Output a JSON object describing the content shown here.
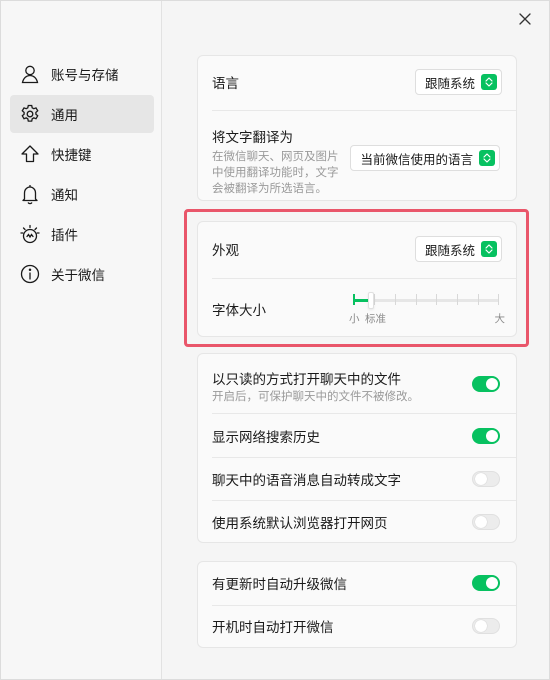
{
  "sidebar": {
    "items": [
      {
        "label": "账号与存储",
        "icon": "user-icon"
      },
      {
        "label": "通用",
        "icon": "gear-icon",
        "active": true
      },
      {
        "label": "快捷键",
        "icon": "arrow-up-icon"
      },
      {
        "label": "通知",
        "icon": "bell-icon"
      },
      {
        "label": "插件",
        "icon": "plugin-icon"
      },
      {
        "label": "关于微信",
        "icon": "info-icon"
      }
    ]
  },
  "language": {
    "label": "语言",
    "value": "跟随系统"
  },
  "translate": {
    "label": "将文字翻译为",
    "description_lines": [
      "在微信聊天、网页及图片",
      "中使用翻译功能时，文字",
      "会被翻译为所选语言。"
    ],
    "value": "当前微信使用的语言"
  },
  "appearance": {
    "label": "外观",
    "value": "跟随系统"
  },
  "font_size": {
    "label": "字体大小",
    "min_label": "小",
    "standard_label": "标准",
    "max_label": "大",
    "level_index": 1,
    "level_count": 8
  },
  "files": {
    "readonly_label": "以只读的方式打开聊天中的文件",
    "readonly_desc": "开启后，可保护聊天中的文件不被修改。",
    "readonly_on": true,
    "search_history_label": "显示网络搜索历史",
    "search_history_on": true,
    "voice_to_text_label": "聊天中的语音消息自动转成文字",
    "voice_to_text_on": false,
    "system_browser_label": "使用系统默认浏览器打开网页",
    "system_browser_on": false
  },
  "update": {
    "auto_upgrade_label": "有更新时自动升级微信",
    "auto_upgrade_on": true,
    "auto_launch_label": "开机时自动打开微信",
    "auto_launch_on": false
  },
  "colors": {
    "accent": "#07c160",
    "highlight": "#e9566a"
  }
}
